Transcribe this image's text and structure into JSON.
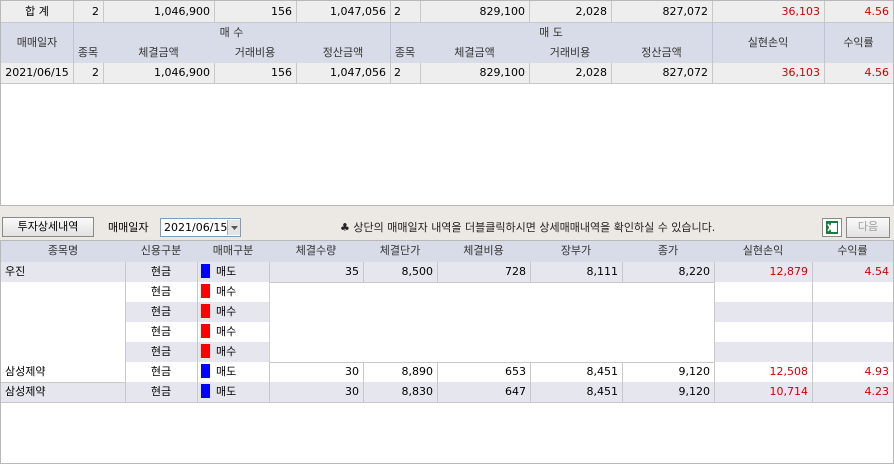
{
  "summary_totals": {
    "label": "합 계",
    "buy_count": "2",
    "buy_amount": "1,046,900",
    "buy_fee": "156",
    "buy_settle": "1,047,056",
    "sell_count": "2",
    "sell_amount": "829,100",
    "sell_fee": "2,028",
    "sell_settle": "827,072",
    "profit": "36,103",
    "rate": "4.56"
  },
  "summary_headers": {
    "date": "매매일자",
    "buy_group": "매 수",
    "sell_group": "매 도",
    "profit": "실현손익",
    "rate": "수익률",
    "count": "종목",
    "amount": "체결금액",
    "fee": "거래비용",
    "settle": "정산금액"
  },
  "summary_rows": [
    {
      "date": "2021/06/15",
      "buy_count": "2",
      "buy_amount": "1,046,900",
      "buy_fee": "156",
      "buy_settle": "1,047,056",
      "sell_count": "2",
      "sell_amount": "829,100",
      "sell_fee": "2,028",
      "sell_settle": "827,072",
      "profit": "36,103",
      "rate": "4.56"
    }
  ],
  "toolbar": {
    "detail_button": "투자상세내역",
    "date_label": "매매일자",
    "date_value": "2021/06/15",
    "hint": "♣ 상단의 매매일자 내역을 더블클릭하시면 상세매매내역을 확인하실 수 있습니다.",
    "next_button": "다음",
    "excel_icon": "excel-icon"
  },
  "detail_headers": [
    "종목명",
    "신용구분",
    "매매구분",
    "체결수량",
    "체결단가",
    "체결비용",
    "장부가",
    "종가",
    "실현손익",
    "수익률"
  ],
  "detail_rows": [
    {
      "name": "우진",
      "credit": "현금",
      "side": "매도",
      "color": "#0000ff",
      "qty": "35",
      "price": "8,500",
      "cost": "728",
      "book": "8,111",
      "close": "8,220",
      "profit": "12,879",
      "rate": "4.54"
    },
    {
      "name": "",
      "credit": "현금",
      "side": "매수",
      "color": "#ff0000",
      "qty": "",
      "price": "",
      "cost": "",
      "book": "",
      "close": "",
      "profit": "",
      "rate": ""
    },
    {
      "name": "",
      "credit": "현금",
      "side": "매수",
      "color": "#ff0000",
      "qty": "",
      "price": "",
      "cost": "",
      "book": "",
      "close": "",
      "profit": "",
      "rate": ""
    },
    {
      "name": "",
      "credit": "현금",
      "side": "매수",
      "color": "#ff0000",
      "qty": "",
      "price": "",
      "cost": "",
      "book": "",
      "close": "",
      "profit": "",
      "rate": ""
    },
    {
      "name": "",
      "credit": "현금",
      "side": "매수",
      "color": "#ff0000",
      "qty": "",
      "price": "",
      "cost": "",
      "book": "",
      "close": "",
      "profit": "",
      "rate": ""
    },
    {
      "name": "삼성제약",
      "credit": "현금",
      "side": "매도",
      "color": "#0000ff",
      "qty": "30",
      "price": "8,890",
      "cost": "653",
      "book": "8,451",
      "close": "9,120",
      "profit": "12,508",
      "rate": "4.93"
    },
    {
      "name": "삼성제약",
      "credit": "현금",
      "side": "매도",
      "color": "#0000ff",
      "qty": "30",
      "price": "8,830",
      "cost": "647",
      "book": "8,451",
      "close": "9,120",
      "profit": "10,714",
      "rate": "4.23"
    }
  ],
  "colors": {
    "header_bg": "#d8dce8",
    "stripe_bg": "#e6e6ee",
    "profit_text": "#d00000",
    "buy_marker": "#ff0000",
    "sell_marker": "#0000ff"
  }
}
